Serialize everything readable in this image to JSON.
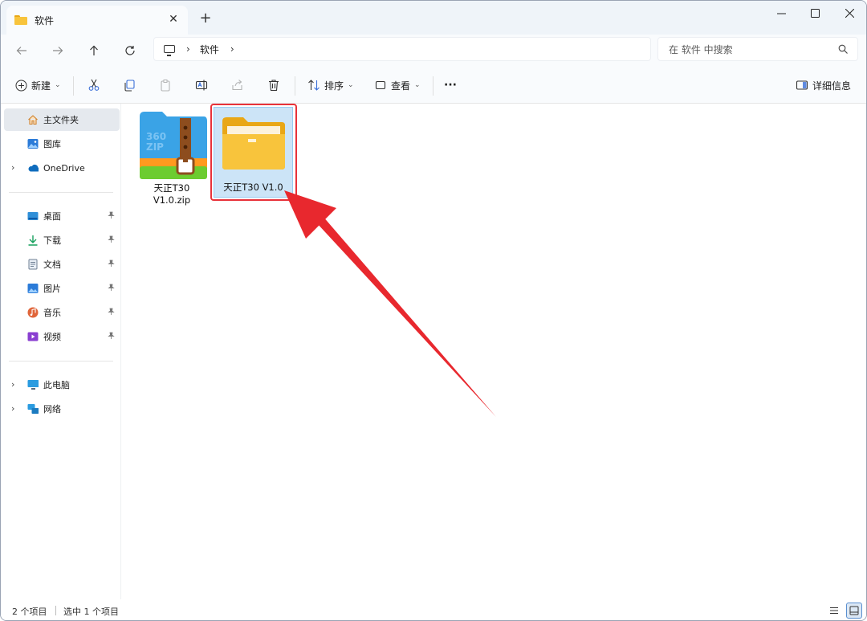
{
  "window": {
    "tab_title": "软件",
    "tab_close": "✕",
    "new_tab": "+"
  },
  "window_controls": {
    "minimize": "—",
    "maximize": "☐",
    "close": "✕"
  },
  "address": {
    "path_sep": "›",
    "crumbs": [
      "软件"
    ],
    "search_placeholder": "在 软件 中搜索"
  },
  "toolbar": {
    "new_label": "新建",
    "sort_label": "排序",
    "view_label": "查看",
    "more_label": "···",
    "details_label": "详细信息",
    "caret": "⌄"
  },
  "sidebar": {
    "home": "主文件夹",
    "gallery": "图库",
    "onedrive": "OneDrive",
    "quick_access": [
      "桌面",
      "下载",
      "文档",
      "图片",
      "音乐",
      "视频"
    ],
    "this_pc": "此电脑",
    "network": "网络",
    "expand_glyph": "›",
    "pin_glyph": "📌"
  },
  "files": [
    {
      "name_line1": "天正T30",
      "name_line2": "V1.0.zip",
      "type": "zip",
      "brand_text": "360",
      "brand_sub": "ZIP"
    },
    {
      "name": "天正T30 V1.0",
      "type": "folder",
      "selected": true
    }
  ],
  "status": {
    "item_count": "2 个项目",
    "selected_count": "选中 1 个项目"
  },
  "colors": {
    "accent": "#0067c0",
    "selection": "#cce4f7",
    "highlight_red": "#e8323a",
    "folder_yellow": "#f8c43c"
  }
}
